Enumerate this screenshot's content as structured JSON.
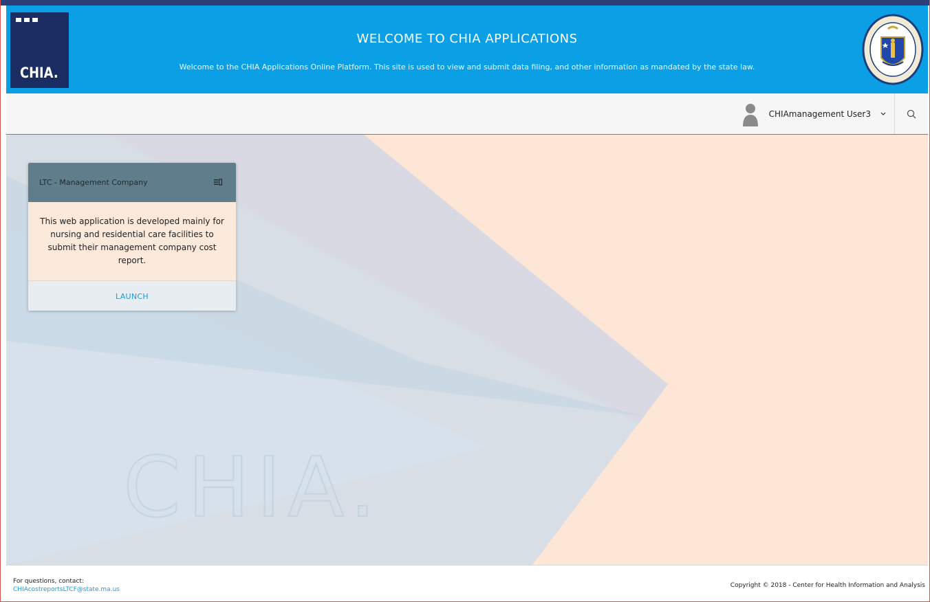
{
  "header": {
    "logo_text": "CHIA.",
    "title": "WELCOME TO CHIA APPLICATIONS",
    "subtitle": "Welcome to the CHIA Applications Online Platform. This site is used to view and submit data filing, and other information as mandated by the state law.",
    "seal_icon": "massachusetts-seal-icon"
  },
  "toolbar": {
    "user_name": "CHIAmanagement User3",
    "dropdown_icon": "chevron-down-icon",
    "search_icon": "search-icon"
  },
  "background": {
    "watermark_text": "CHIA."
  },
  "cards": [
    {
      "title": "LTC - Management Company",
      "menu_icon": "menu-icon",
      "description": "This web application is developed mainly for nursing and residential care facilities to submit their management company cost report.",
      "action_label": "LAUNCH"
    }
  ],
  "footer": {
    "contact_label": "For questions, contact:",
    "contact_email": "CHIAcostreportsLTCF@state.ma.us",
    "copyright": "Copyright © 2018 - Center for Health Information and Analysis"
  },
  "colors": {
    "banner": "#0ba0e6",
    "logo_bg": "#1b2e63",
    "card_header": "#5f7d8a",
    "link": "#1a9bd7"
  }
}
